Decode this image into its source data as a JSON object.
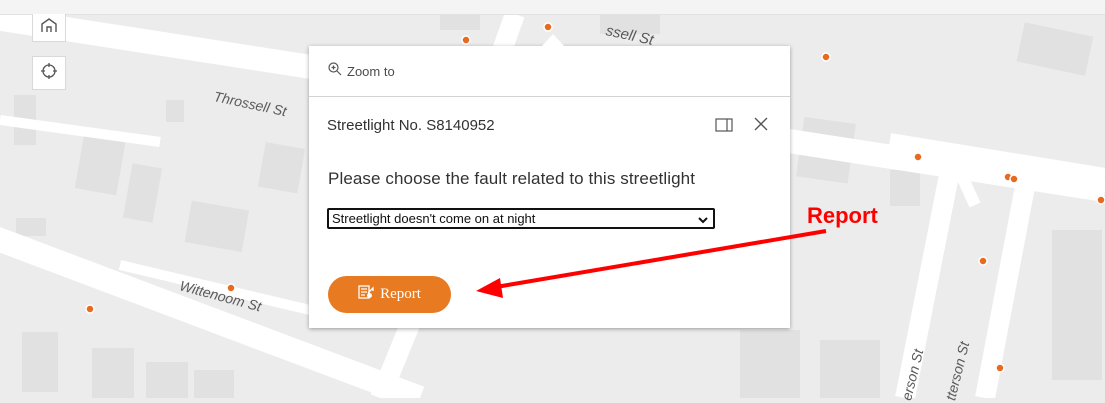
{
  "map": {
    "colors": {
      "background": "#ececec",
      "road": "#ffffff",
      "building": "#e1e1e1",
      "poi": "#e86a1f"
    },
    "street_labels": {
      "throssell_top": "ssell St",
      "throssell": "Throssell St",
      "wittenoom": "Wittenoom St",
      "anderson_a": "erson St",
      "anderson_b": "tterson St"
    },
    "controls": {
      "home_icon": "home-icon",
      "locate_icon": "locate-icon"
    }
  },
  "popup": {
    "zoom_to_label": "Zoom to",
    "title": "Streetlight No. S8140952",
    "question": "Please choose the fault related to this streetlight",
    "fault_select": {
      "selected_value": "Streetlight doesn't come on at night"
    },
    "report_button_label": "Report",
    "colors": {
      "report_button": "#e87a22"
    }
  },
  "annotation": {
    "label": "Report",
    "color": "#ff0000"
  }
}
